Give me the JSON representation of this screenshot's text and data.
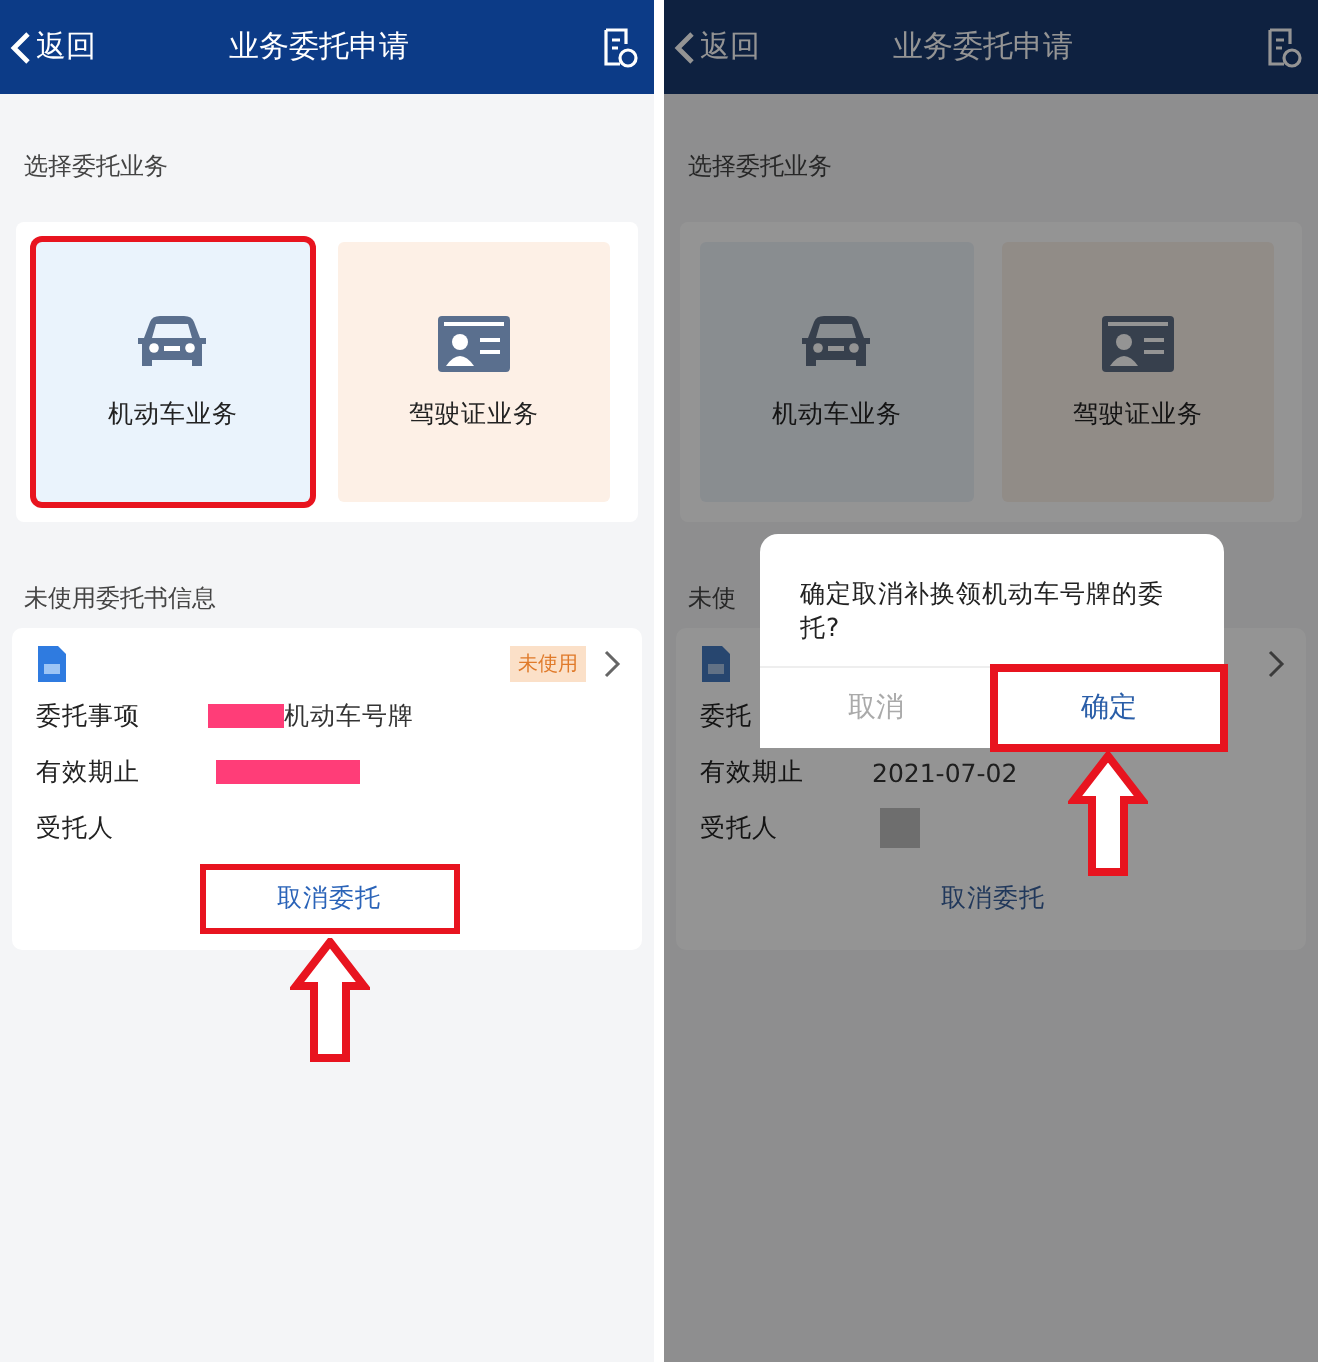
{
  "panels": [
    {
      "dimmed": false,
      "nav": {
        "back": "返回",
        "title": "业务委托申请"
      },
      "section_title": "选择委托业务",
      "services": [
        {
          "kind": "car",
          "label": "机动车业务",
          "highlighted": true
        },
        {
          "kind": "license",
          "label": "驾驶证业务",
          "highlighted": false
        }
      ],
      "info_title": "未使用委托书信息",
      "card": {
        "badge": "未使用",
        "rows": [
          {
            "label": "委托事项",
            "value": "机动车号牌",
            "color": "#ff3d78"
          },
          {
            "label": "有效期止",
            "color": "#ff3d78"
          },
          {
            "label": "受托人"
          }
        ],
        "action": "取消委托",
        "action_highlighted": true
      }
    },
    {
      "dimmed": true,
      "nav": {
        "back": "返回",
        "title": "业务委托申请"
      },
      "section_title": "选择委托业务",
      "services": [
        {
          "kind": "car",
          "label": "机动车业务",
          "highlighted": false
        },
        {
          "kind": "license",
          "label": "驾驶证业务",
          "highlighted": false
        }
      ],
      "info_title": "未使",
      "card": {
        "rows": [
          {
            "label": "委托"
          },
          {
            "label": "有效期止",
            "value": "2021-07-02"
          },
          {
            "label": "受托人",
            "color": "#6e6e6e"
          }
        ],
        "action": "取消委托",
        "action_highlighted": false
      },
      "dialog": {
        "message": "确定取消补换领机动车号牌的委托?",
        "cancel": "取消",
        "confirm": "确定",
        "confirm_highlighted": true
      }
    }
  ]
}
